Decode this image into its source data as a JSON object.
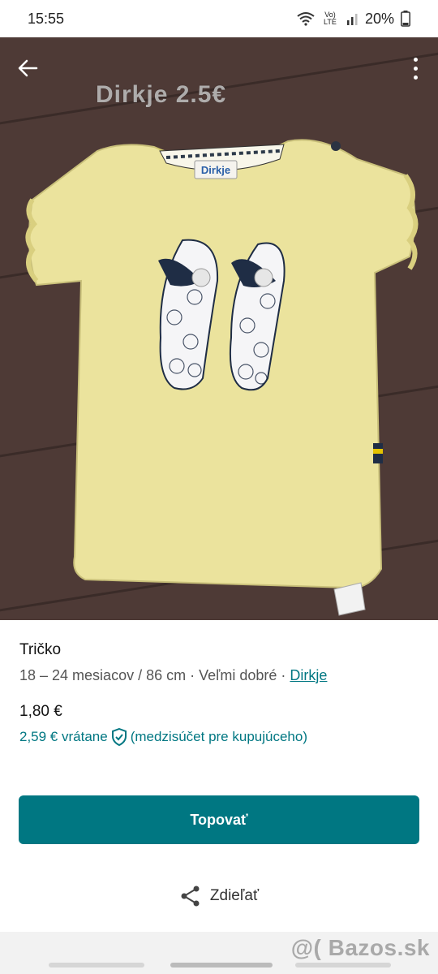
{
  "status": {
    "time": "15:55",
    "battery": "20%",
    "network": "Vo) LTE"
  },
  "photo": {
    "overlay_text": "Dirkje  2.5€",
    "label_text": "Dirkje"
  },
  "item": {
    "title": "Tričko",
    "size": "18 – 24 mesiacov / 86 cm",
    "separator": " · ",
    "condition": "Veľmi dobré",
    "brand": "Dirkje",
    "price": "1,80 €",
    "price_incl": "2,59 € vrátane",
    "price_incl_note": "(medzisúčet pre kupujúceho)"
  },
  "actions": {
    "bump_label": "Topovať",
    "share_label": "Zdieľať"
  },
  "footer": {
    "watermark": "@( Bazos.sk"
  },
  "colors": {
    "accent": "#007782",
    "shirt": "#e9e29a",
    "wood": "#4e3a36"
  }
}
